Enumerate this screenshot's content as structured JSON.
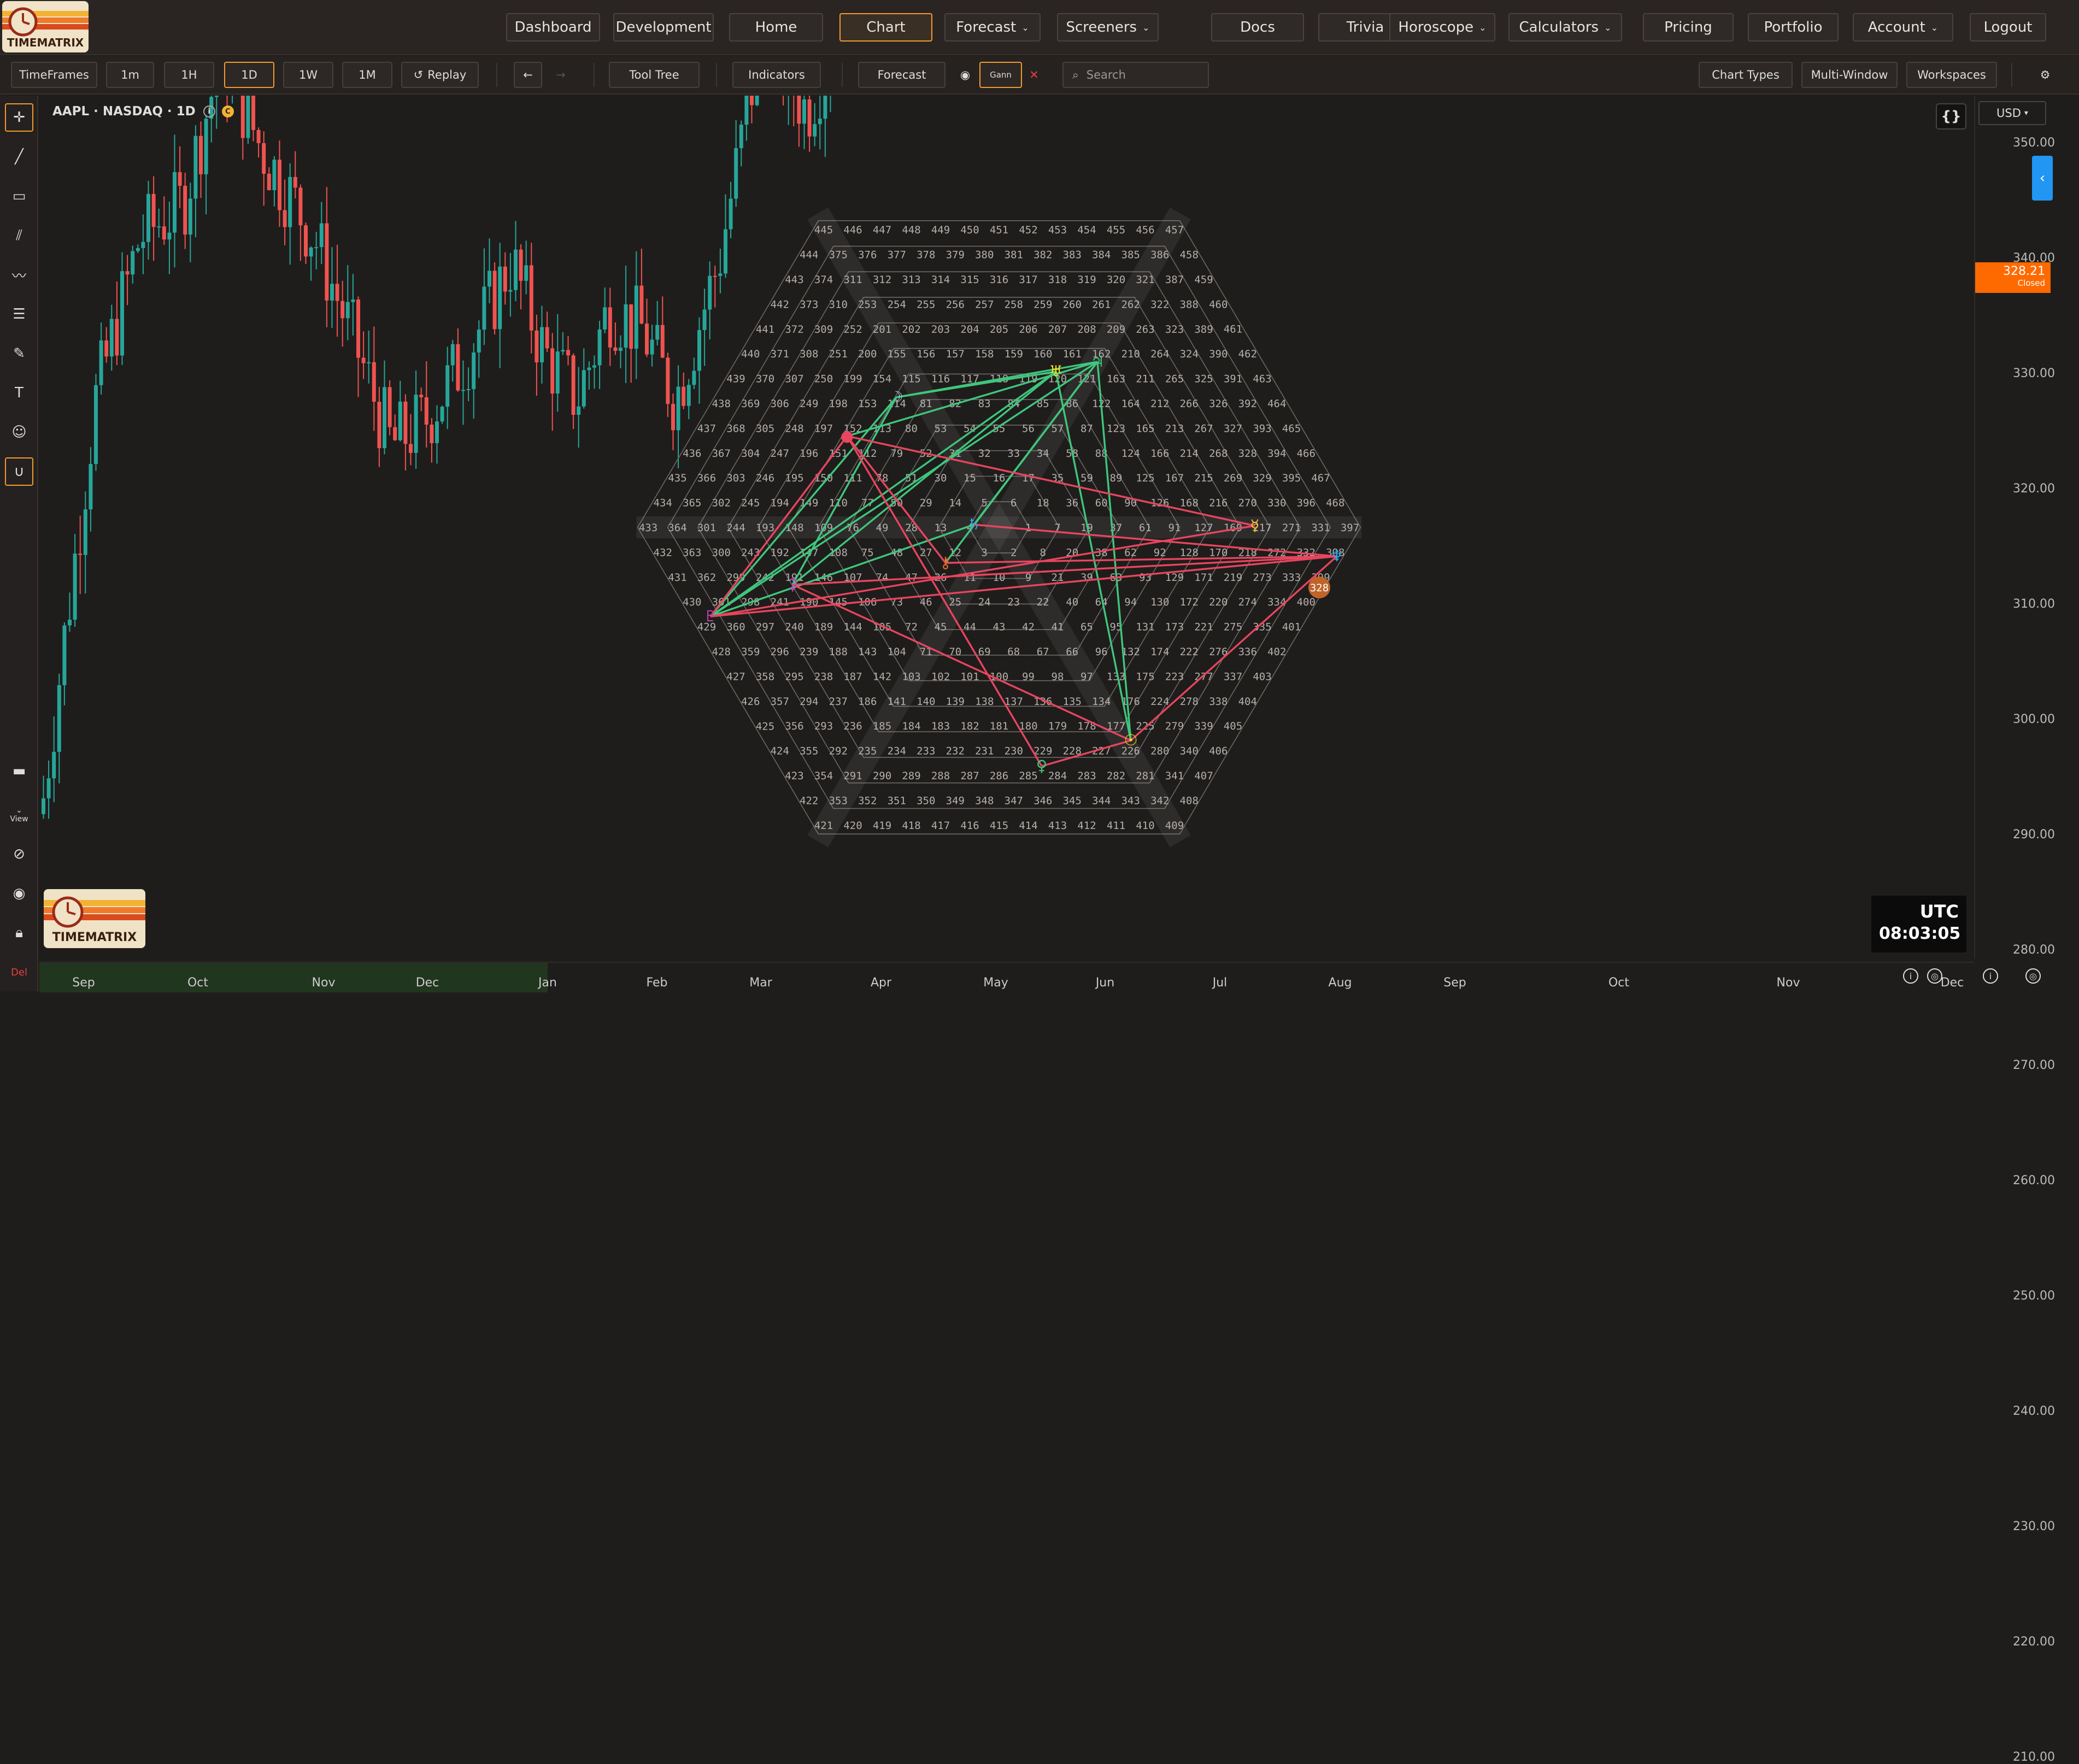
{
  "app": {
    "brand": "TIMEMATRIX"
  },
  "nav": [
    {
      "label": "Dashboard"
    },
    {
      "label": "Development"
    },
    {
      "label": "Home"
    },
    {
      "label": "Chart",
      "active": true
    },
    {
      "label": "Forecast",
      "dropdown": true
    },
    {
      "label": "Screeners",
      "dropdown": true
    },
    {
      "label": "Docs"
    },
    {
      "label": "Trivia"
    },
    {
      "label": "Horoscope",
      "dropdown": true
    },
    {
      "label": "Calculators",
      "dropdown": true
    },
    {
      "label": "Pricing"
    },
    {
      "label": "Portfolio"
    },
    {
      "label": "Account",
      "dropdown": true
    },
    {
      "label": "Logout"
    }
  ],
  "toolbar": {
    "timeframes": "TimeFrames",
    "tf_1m": "1m",
    "tf_1h": "1H",
    "tf_1d": "1D",
    "tf_1w": "1W",
    "tf_1mo": "1M",
    "replay": "Replay",
    "tool_tree": "Tool Tree",
    "indicators": "Indicators",
    "forecast": "Forecast",
    "gann": "Gann",
    "search_placeholder": "Search",
    "chart_types": "Chart Types",
    "multi_window": "Multi-Window",
    "workspaces": "Workspaces"
  },
  "chart": {
    "symbol_title": "AAPL · NASDAQ · 1D",
    "currency": "USD",
    "last_price": "328.21",
    "last_price_status": "Closed",
    "timezone": "UTC",
    "clock": "08:03:05",
    "code_button": "{}",
    "price_ticks": [
      "350.00",
      "340.00",
      "330.00",
      "320.00",
      "310.00",
      "300.00",
      "290.00",
      "280.00",
      "270.00",
      "260.00",
      "250.00",
      "240.00",
      "230.00",
      "220.00",
      "210.00"
    ],
    "months": [
      "Sep",
      "Oct",
      "Nov",
      "Dec",
      "Jan",
      "Feb",
      "Mar",
      "Apr",
      "May",
      "Jun",
      "Jul",
      "Aug",
      "Sep",
      "Oct",
      "Nov",
      "Dec"
    ]
  },
  "left_tools": [
    "cursor-icon",
    "trend-line-icon",
    "rectangle-icon",
    "parallel-channel-icon",
    "pattern-icon",
    "fibonacci-icon",
    "brush-icon",
    "text-icon",
    "emoji-icon",
    "magnet-icon"
  ],
  "left_bottom": {
    "view": "View",
    "del": "Del"
  },
  "gann": {
    "highlighted": "328"
  },
  "colors": {
    "accent": "#f29a2e",
    "up": "#26a69a",
    "down": "#ef5350",
    "green_line": "#3ec77d",
    "red_line": "#e8455f",
    "price_tag": "#ff6a00"
  }
}
